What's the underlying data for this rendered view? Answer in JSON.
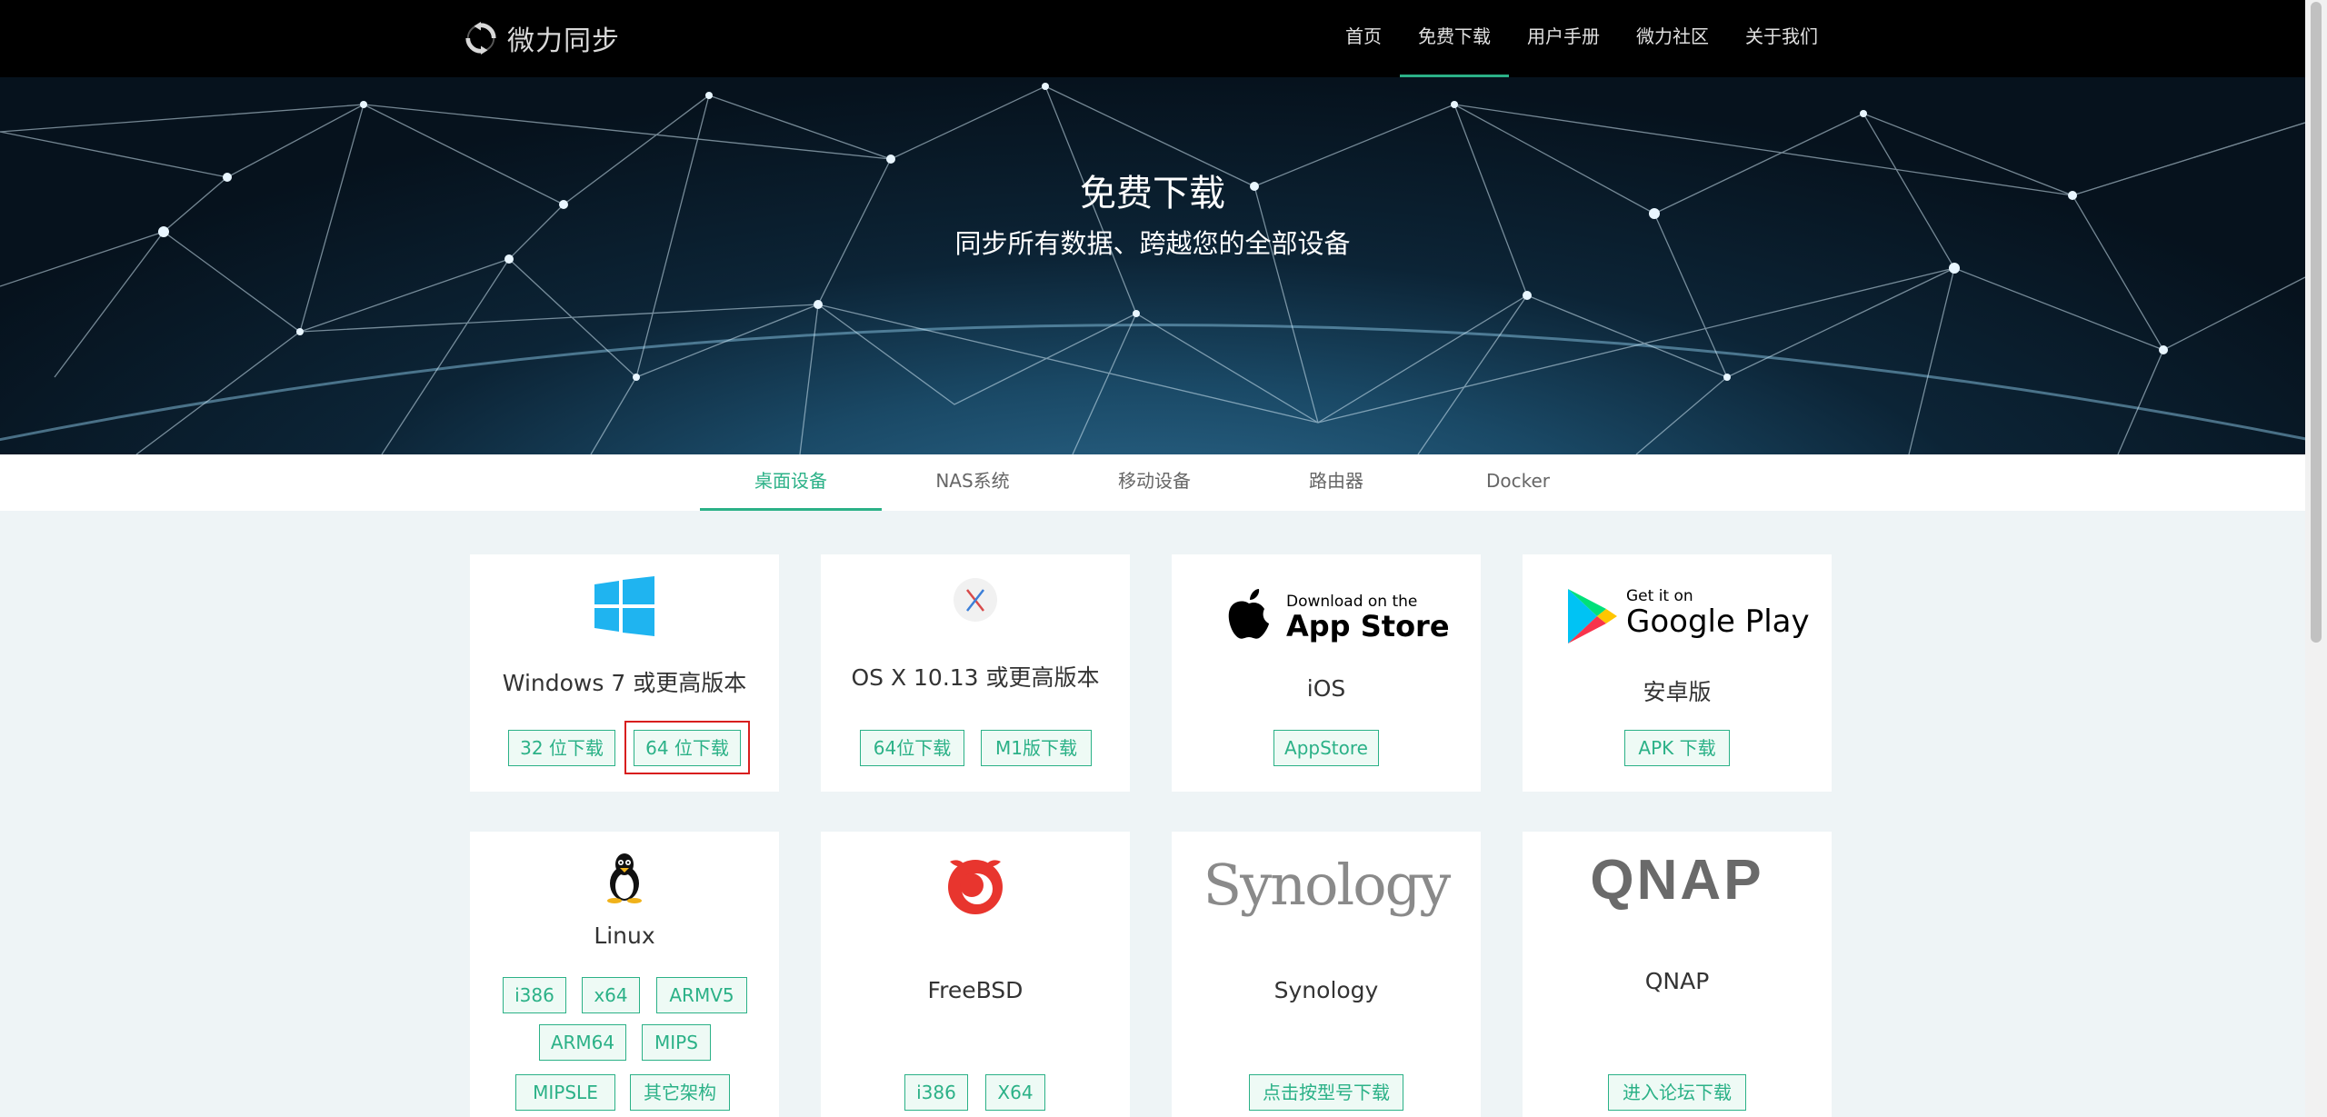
{
  "brand": {
    "name": "微力同步"
  },
  "nav": [
    {
      "label": "首页"
    },
    {
      "label": "免费下载"
    },
    {
      "label": "用户手册"
    },
    {
      "label": "微力社区"
    },
    {
      "label": "关于我们"
    }
  ],
  "hero": {
    "title": "免费下载",
    "subtitle": "同步所有数据、跨越您的全部设备"
  },
  "tabs": [
    {
      "label": "桌面设备"
    },
    {
      "label": "NAS系统"
    },
    {
      "label": "移动设备"
    },
    {
      "label": "路由器"
    },
    {
      "label": "Docker"
    }
  ],
  "cards": {
    "windows": {
      "title": "Windows 7 或更高版本",
      "buttons": [
        "32 位下载",
        "64 位下载"
      ]
    },
    "macos": {
      "title": "OS X 10.13 或更高版本",
      "buttons": [
        "64位下载",
        "M1版下载"
      ]
    },
    "ios": {
      "badge_small": "Download on the",
      "badge_big": "App Store",
      "title": "iOS",
      "buttons": [
        "AppStore"
      ]
    },
    "android": {
      "badge_small": "Get it on",
      "badge_big": "Google Play",
      "title": "安卓版",
      "buttons": [
        "APK 下载"
      ]
    },
    "linux": {
      "title": "Linux",
      "buttons": [
        "i386",
        "x64",
        "ARMV5",
        "ARM64",
        "MIPS",
        "MIPSLE",
        "其它架构"
      ]
    },
    "freebsd": {
      "title": "FreeBSD",
      "buttons": [
        "i386",
        "X64"
      ]
    },
    "synology": {
      "logo": "Synology",
      "title": "Synology",
      "buttons": [
        "点击按型号下载"
      ]
    },
    "qnap": {
      "logo": "QNAP",
      "title": "QNAP",
      "buttons": [
        "进入论坛下载"
      ]
    }
  },
  "colors": {
    "accent": "#2bb187",
    "highlight": "#d81e1e",
    "nav_bg": "#000000"
  }
}
